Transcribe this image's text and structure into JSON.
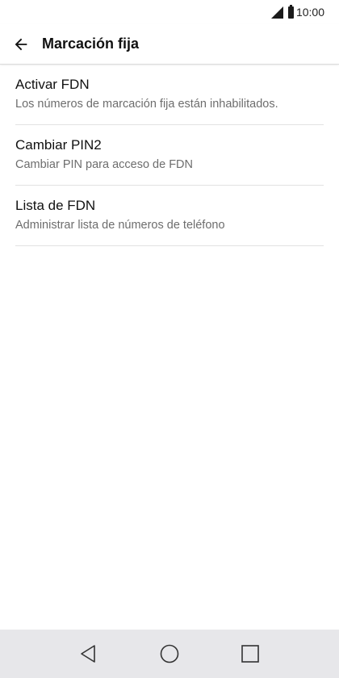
{
  "status_bar": {
    "time": "10:00",
    "signal_icon": "cell-signal-icon",
    "battery_icon": "battery-icon"
  },
  "app_bar": {
    "title": "Marcación fija",
    "back_icon": "arrow-left-icon"
  },
  "items": [
    {
      "primary": "Activar FDN",
      "secondary": "Los números de marcación fija están inhabilitados."
    },
    {
      "primary": "Cambiar PIN2",
      "secondary": "Cambiar PIN para acceso de FDN"
    },
    {
      "primary": "Lista de FDN",
      "secondary": "Administrar lista de números de teléfono"
    }
  ],
  "nav_bar": {
    "back_icon": "triangle-back-icon",
    "home_icon": "circle-home-icon",
    "recents_icon": "square-recents-icon",
    "background_color": "#e7e7ea"
  }
}
